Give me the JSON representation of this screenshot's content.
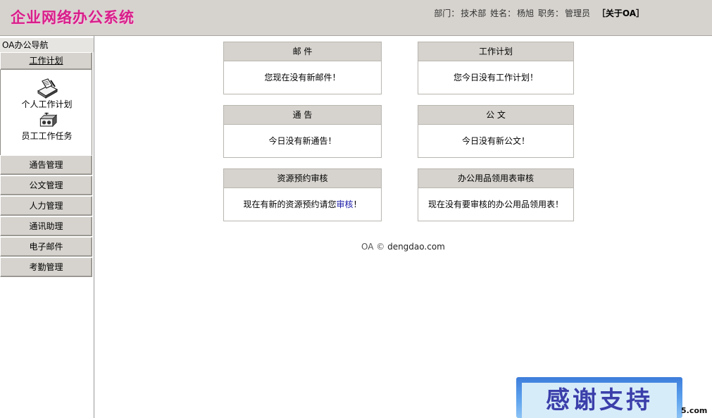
{
  "header": {
    "logo": "企业网络办公系统",
    "dept_label": "部门：",
    "dept": "技术部",
    "name_label": "姓名：",
    "name": "杨旭",
    "role_label": "职务：",
    "role": "管理员",
    "about": "［关于OA］"
  },
  "sidebar": {
    "title": "OA办公导航",
    "open_menu": "工作计划",
    "sub_items": [
      {
        "label": "个人工作计划",
        "icon": "personal-plan-icon"
      },
      {
        "label": "员工工作任务",
        "icon": "staff-task-icon"
      }
    ],
    "menus": [
      "通告管理",
      "公文管理",
      "人力管理",
      "通讯助理",
      "电子邮件",
      "考勤管理"
    ]
  },
  "panels": {
    "mail": {
      "title": "邮  件",
      "body": "您现在没有新邮件！"
    },
    "plan": {
      "title": "工作计划",
      "body": "您今日没有工作计划！"
    },
    "notice": {
      "title": "通  告",
      "body": "今日没有新通告！"
    },
    "doc": {
      "title": "公  文",
      "body": "今日没有新公文！"
    },
    "resource": {
      "title": "资源预约审核",
      "body_prefix": "现在有新的资源预约请您",
      "body_link": "审核",
      "body_suffix": "！"
    },
    "supplies": {
      "title": "办公用品领用表审核",
      "body": "现在没有要审核的办公用品领用表！"
    }
  },
  "footer": {
    "prefix": "OA © ",
    "domain": "dengdao.com"
  },
  "watermark": {
    "text": "感谢支持",
    "suffix": "5.com"
  },
  "colors": {
    "logo": "#d81e8a",
    "chrome": "#d6d3ce",
    "link": "#1a1aa8"
  }
}
